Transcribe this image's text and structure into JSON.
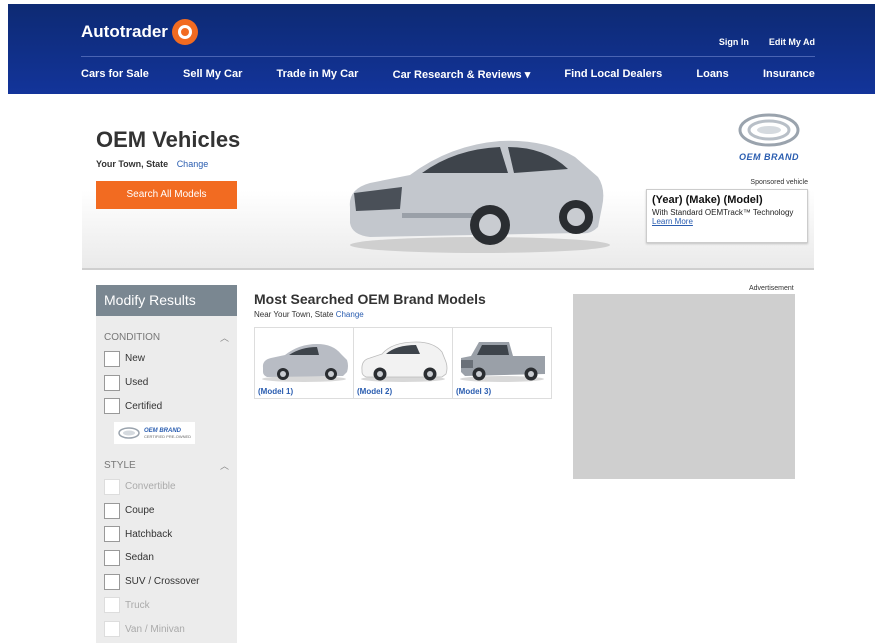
{
  "header": {
    "logo_text": "Autotrader",
    "top_links": [
      "Sign In",
      "Edit My Ad"
    ],
    "nav": [
      "Cars for Sale",
      "Sell My Car",
      "Trade in My Car",
      "Car Research & Reviews ▾",
      "Find Local Dealers",
      "Loans",
      "Insurance"
    ]
  },
  "hero": {
    "title": "OEM Vehicles",
    "location": "Your Town, State",
    "change_label": "Change",
    "button_label": "Search All Models",
    "brand_name": "OEM BRAND",
    "sponsored_label": "Sponsored vehicle",
    "sponsor": {
      "title": "(Year) (Make) (Model)",
      "description": "With Standard OEMTrack™ Technology",
      "link": "Learn More"
    }
  },
  "sidebar": {
    "title": "Modify Results",
    "condition": {
      "label": "CONDITION",
      "items": [
        {
          "label": "New",
          "enabled": true
        },
        {
          "label": "Used",
          "enabled": true
        },
        {
          "label": "Certified",
          "enabled": true
        }
      ],
      "cpo_brand": "OEM BRAND",
      "cpo_sub": "CERTIFIED PRE-OWNED"
    },
    "style": {
      "label": "STYLE",
      "items": [
        {
          "label": "Convertible",
          "enabled": false
        },
        {
          "label": "Coupe",
          "enabled": true
        },
        {
          "label": "Hatchback",
          "enabled": true
        },
        {
          "label": "Sedan",
          "enabled": true
        },
        {
          "label": "SUV / Crossover",
          "enabled": true
        },
        {
          "label": "Truck",
          "enabled": false
        },
        {
          "label": "Van / Minivan",
          "enabled": false
        }
      ]
    }
  },
  "main": {
    "title": "Most Searched OEM Brand Models",
    "location_prefix": "Near Your Town, State",
    "change_label": "Change",
    "models": [
      {
        "label": "(Model 1)",
        "icon": "sedan-icon",
        "color": "#b8bcc4"
      },
      {
        "label": "(Model 2)",
        "icon": "suv-icon",
        "color": "#f2f2f2"
      },
      {
        "label": "(Model 3)",
        "icon": "truck-icon",
        "color": "#9aa0a8"
      }
    ]
  },
  "ad": {
    "label": "Advertisement"
  },
  "colors": {
    "header_bg": "#13349a",
    "accent_orange": "#f26b21",
    "link_blue": "#2a5db0",
    "sidebar_header": "#7a8791"
  }
}
